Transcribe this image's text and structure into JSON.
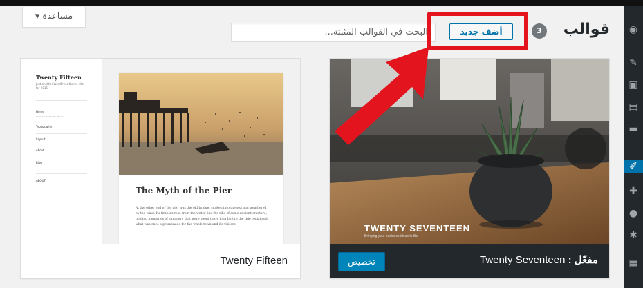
{
  "help": {
    "label": "مساعدة ▾"
  },
  "header": {
    "title": "قوالب",
    "count": "3",
    "add_new": "أضف جديد",
    "search_placeholder": "البحث في القوالب المثبتة..."
  },
  "themes": [
    {
      "name": "Twenty Seventeen",
      "active_prefix": "مفعّل :",
      "customize_label": "تخصيص",
      "screenshot_title": "TWENTY SEVENTEEN",
      "screenshot_sub": "Bringing your business ideas to life"
    },
    {
      "name": "Twenty Fifteen",
      "screenshot": {
        "site_title": "Twenty Fifteen",
        "site_desc": "Just another WordPress theme site for 2015.",
        "nav": [
          "Home",
          "Welcome to Twenty Fifteen",
          "Typography",
          "Layout",
          "About",
          "Blog"
        ],
        "widget_title": "ABOUT",
        "post_title": "The Myth of the Pier",
        "post_excerpt": "At the other end of the pier was the old bridge, sunken into the sea and weathered by the wind. Its timbers rose from the water like the ribs of some ancient creature, holding memories of summers that were spent there long before the tide reclaimed what was once a promenade for the whole town and its visitors."
      }
    }
  ],
  "colors": {
    "admin_bar": "#111111",
    "sidebar": "#23282d",
    "accent": "#0073aa",
    "annotation_red": "#e3141d"
  },
  "sidebar_icons": [
    "dashboard-icon",
    "posts-icon",
    "media-icon",
    "pages-icon",
    "comments-icon",
    "appearance-icon",
    "plugins-icon",
    "users-icon",
    "tools-icon",
    "settings-icon"
  ]
}
